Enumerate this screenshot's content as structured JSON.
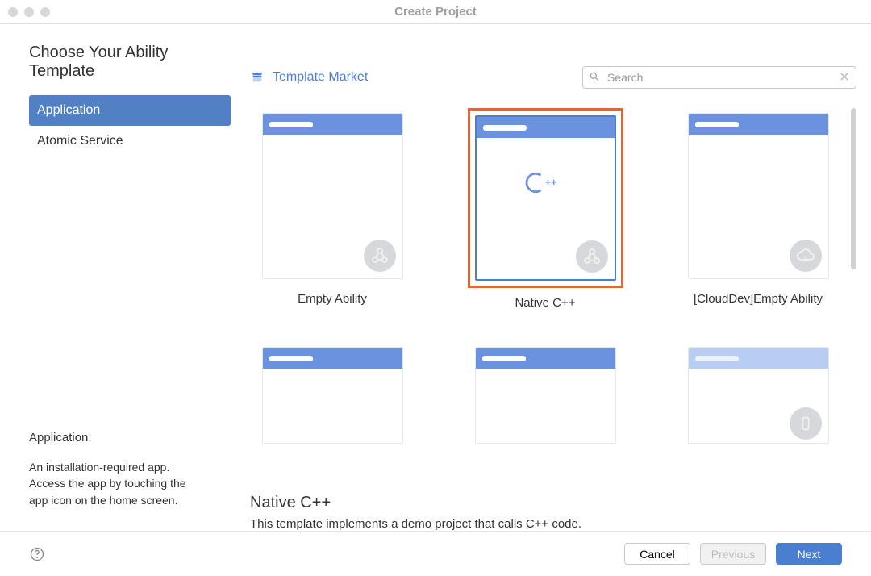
{
  "window": {
    "title": "Create Project"
  },
  "heading": "Choose Your Ability Template",
  "sidebar": {
    "tabs": [
      {
        "label": "Application",
        "active": true
      },
      {
        "label": "Atomic Service",
        "active": false
      }
    ],
    "info_title": "Application:",
    "info_desc": "An installation-required app. Access the app by touching the app icon on the home screen."
  },
  "topbar": {
    "market_label": "Template Market",
    "search_placeholder": "Search"
  },
  "templates": {
    "items": [
      {
        "label": "Empty Ability"
      },
      {
        "label": "Native C++"
      },
      {
        "label": "[CloudDev]Empty Ability"
      }
    ]
  },
  "selected": {
    "title": "Native C++",
    "desc": "This template implements a demo project that calls C++ code."
  },
  "footer": {
    "cancel": "Cancel",
    "previous": "Previous",
    "next": "Next"
  }
}
